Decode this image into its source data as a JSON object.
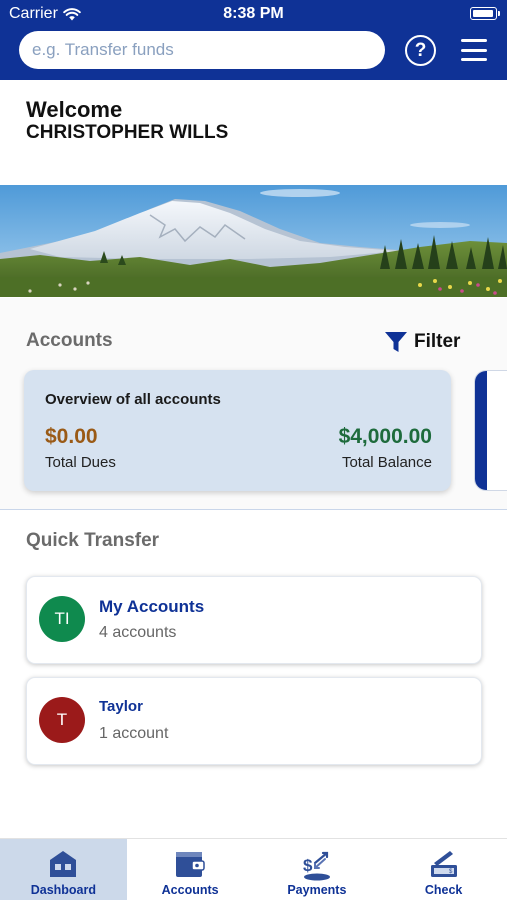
{
  "status_bar": {
    "carrier": "Carrier",
    "time": "8:38 PM",
    "wifi_icon": "wifi-icon",
    "battery_icon": "battery-icon"
  },
  "header": {
    "search": {
      "placeholder": "e.g. Transfer funds",
      "value": ""
    },
    "help_icon": "help-circle-icon",
    "menu_icon": "hamburger-menu-icon",
    "background_color": "#0f3296"
  },
  "welcome": {
    "greeting": "Welcome",
    "user_name": "CHRISTOPHER WILLS"
  },
  "accounts": {
    "title": "Accounts",
    "filter_label": "Filter",
    "filter_icon": "funnel-icon",
    "overview": {
      "title": "Overview of all accounts",
      "dues_amount": "$0.00",
      "dues_label": "Total Dues",
      "balance_amount": "$4,000.00",
      "balance_label": "Total Balance",
      "dues_color": "#9a5a16",
      "balance_color": "#1e6b3c"
    }
  },
  "quick_transfer": {
    "title": "Quick Transfer",
    "items": [
      {
        "initials": "TI",
        "name": "My Accounts",
        "subtitle": "4 accounts",
        "avatar_color": "#0f8a4e"
      },
      {
        "initials": "T",
        "name": "Taylor",
        "subtitle": "1 account",
        "avatar_color": "#9b1a1a"
      }
    ]
  },
  "tabbar": {
    "active_tab": "Dashboard",
    "tabs": [
      {
        "label": "Dashboard",
        "icon": "dashboard-icon"
      },
      {
        "label": "Accounts",
        "icon": "wallet-icon"
      },
      {
        "label": "Payments",
        "icon": "payments-icon"
      },
      {
        "label": "Check",
        "icon": "check-deposit-icon"
      }
    ]
  }
}
